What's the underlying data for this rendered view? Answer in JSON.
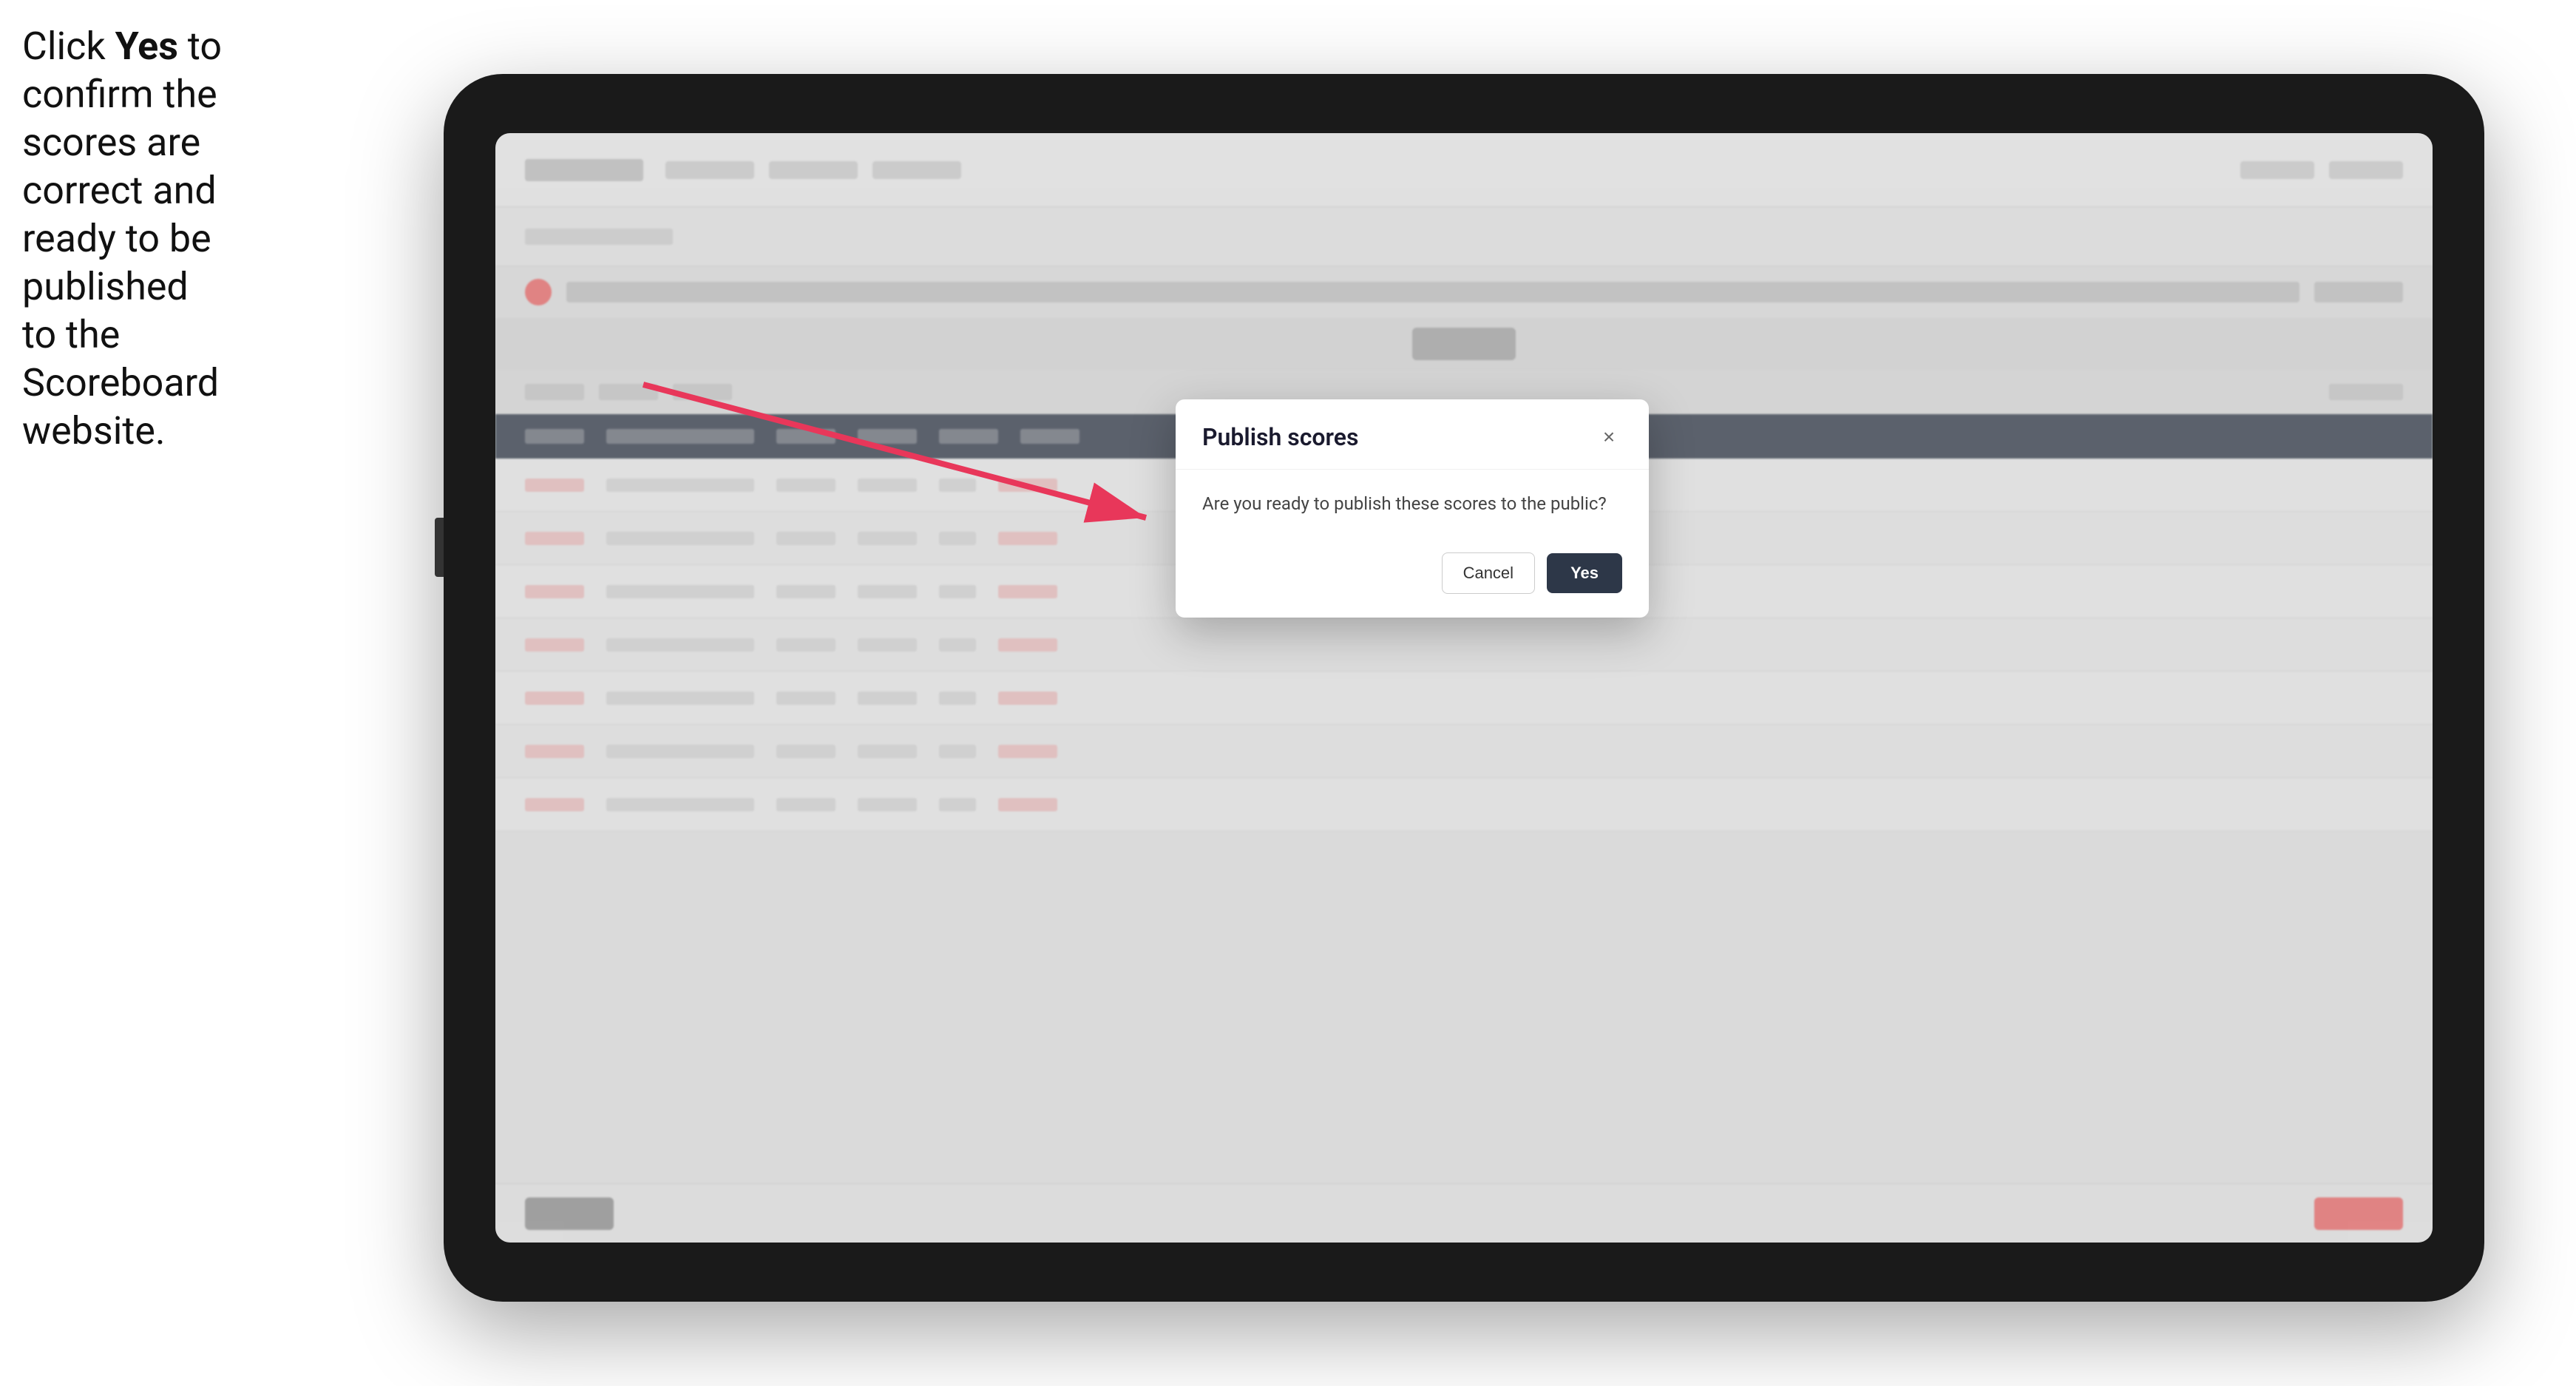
{
  "instruction": {
    "text_part1": "Click ",
    "bold": "Yes",
    "text_part2": " to confirm the scores are correct and ready to be published to the Scoreboard website."
  },
  "tablet": {
    "app": {
      "table_rows": [
        {
          "cells": [
            "wide",
            "",
            "",
            "",
            "small",
            "red"
          ]
        },
        {
          "cells": [
            "wide",
            "",
            "",
            "",
            "small",
            "red"
          ]
        },
        {
          "cells": [
            "wide",
            "",
            "",
            "",
            "small",
            "red"
          ]
        },
        {
          "cells": [
            "wide",
            "",
            "",
            "",
            "small",
            "red"
          ]
        },
        {
          "cells": [
            "wide",
            "",
            "",
            "",
            "small",
            "red"
          ]
        },
        {
          "cells": [
            "wide",
            "",
            "",
            "",
            "small",
            "red"
          ]
        },
        {
          "cells": [
            "wide",
            "",
            "",
            "",
            "small",
            "red"
          ]
        }
      ]
    }
  },
  "modal": {
    "title": "Publish scores",
    "message": "Are you ready to publish these scores to the public?",
    "cancel_label": "Cancel",
    "yes_label": "Yes",
    "close_icon": "×"
  },
  "arrow": {
    "color": "#e8375a"
  }
}
